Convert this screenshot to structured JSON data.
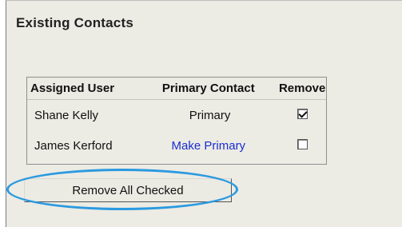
{
  "section_title": "Existing Contacts",
  "table": {
    "headers": {
      "assigned_user": "Assigned User",
      "primary_contact": "Primary Contact",
      "remove": "Remove"
    },
    "rows": [
      {
        "user": "Shane Kelly",
        "primary": "Primary",
        "primary_is_link": false,
        "remove_checked": true
      },
      {
        "user": "James Kerford",
        "primary": "Make Primary",
        "primary_is_link": true,
        "remove_checked": false
      }
    ]
  },
  "remove_all_button": "Remove All Checked",
  "colors": {
    "panel_bg": "#ecebe4",
    "link": "#1a2ed1",
    "highlight_ellipse": "#2a9ae0"
  }
}
